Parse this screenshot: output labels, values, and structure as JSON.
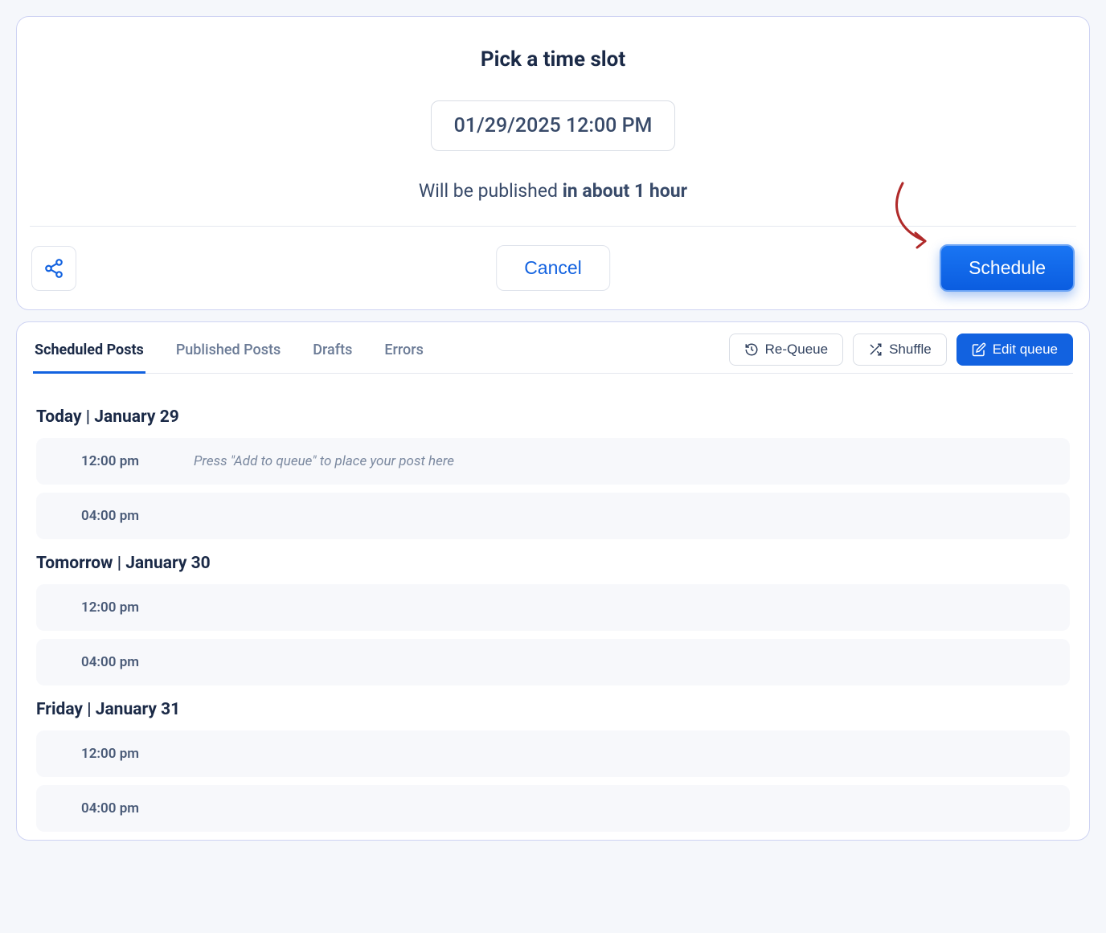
{
  "timeslot": {
    "title": "Pick a time slot",
    "datetime_value": "01/29/2025 12:00 PM",
    "publish_prefix": "Will be published ",
    "publish_relative": "in about 1 hour",
    "cancel_label": "Cancel",
    "schedule_label": "Schedule"
  },
  "queue": {
    "tabs": [
      {
        "label": "Scheduled Posts",
        "active": true
      },
      {
        "label": "Published Posts",
        "active": false
      },
      {
        "label": "Drafts",
        "active": false
      },
      {
        "label": "Errors",
        "active": false
      }
    ],
    "actions": {
      "requeue": "Re-Queue",
      "shuffle": "Shuffle",
      "edit_queue": "Edit queue"
    },
    "days": [
      {
        "label": "Today | January 29",
        "slots": [
          {
            "time": "12:00 pm",
            "hint": "Press \"Add to queue\" to place your post here"
          },
          {
            "time": "04:00 pm",
            "hint": ""
          }
        ]
      },
      {
        "label": "Tomorrow | January 30",
        "slots": [
          {
            "time": "12:00 pm",
            "hint": ""
          },
          {
            "time": "04:00 pm",
            "hint": ""
          }
        ]
      },
      {
        "label": "Friday | January 31",
        "slots": [
          {
            "time": "12:00 pm",
            "hint": ""
          },
          {
            "time": "04:00 pm",
            "hint": ""
          }
        ]
      }
    ]
  }
}
